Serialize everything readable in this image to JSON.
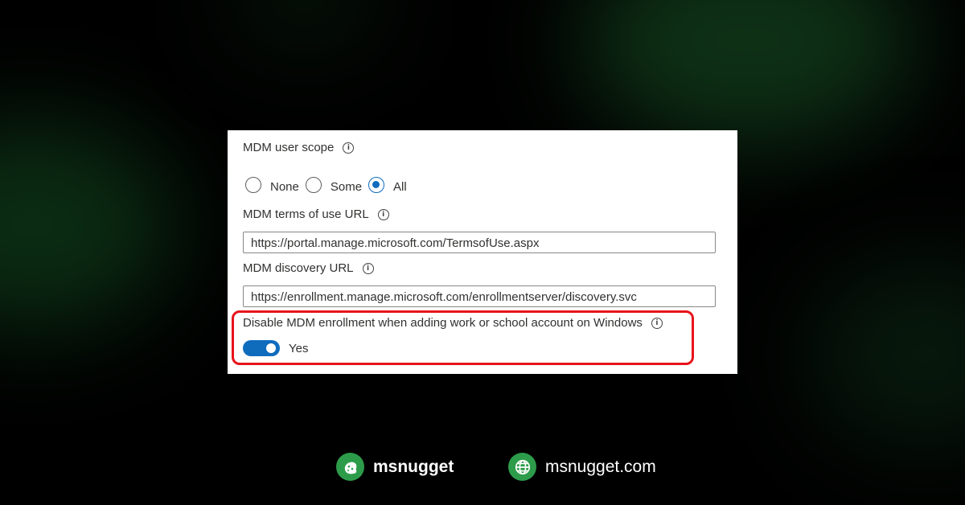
{
  "settings": {
    "user_scope": {
      "label": "MDM user scope",
      "options": [
        "None",
        "Some",
        "All"
      ],
      "selected": "All"
    },
    "terms_url": {
      "label": "MDM terms of use URL",
      "value": "https://portal.manage.microsoft.com/TermsofUse.aspx"
    },
    "discovery_url": {
      "label": "MDM discovery URL",
      "value": "https://enrollment.manage.microsoft.com/enrollmentserver/discovery.svc"
    },
    "disable_enrollment": {
      "label": "Disable MDM enrollment when adding work or school account on Windows",
      "toggle_text": "Yes",
      "enabled": true
    }
  },
  "footer": {
    "brand_name": "msnugget",
    "site": "msnugget.com"
  },
  "colors": {
    "accent": "#0f6cbd",
    "highlight": "#e8131a",
    "brand_green": "#2d9c4a"
  },
  "icons": {
    "info": "info-icon",
    "brand": "nugget-logo-icon",
    "site": "globe-icon"
  }
}
